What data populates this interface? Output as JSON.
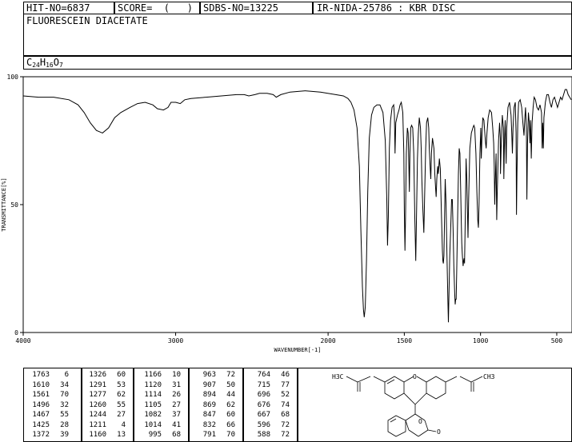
{
  "header": {
    "hit_no": "HIT-NO=6837",
    "score": "SCORE=  (   )",
    "sdbs_no": "SDBS-NO=13225",
    "method": "IR-NIDA-25786 : KBR DISC",
    "compound_name": "FLUORESCEIN DIACETATE",
    "formula": {
      "c": "C",
      "c_n": "24",
      "h": "H",
      "h_n": "16",
      "o": "O",
      "o_n": "7"
    }
  },
  "chart_data": {
    "type": "line",
    "xlabel": "WAVENUMBER[-1]",
    "ylabel": "TRANSMITTANCE[%]",
    "xlim": [
      4000,
      400
    ],
    "ylim": [
      0,
      100
    ],
    "x_ticks": [
      4000,
      3000,
      2000,
      1500,
      1000,
      500
    ],
    "y_ticks": [
      0,
      50,
      100
    ],
    "series": [
      {
        "points": [
          [
            4000,
            92.5
          ],
          [
            3900,
            92
          ],
          [
            3800,
            92
          ],
          [
            3700,
            91
          ],
          [
            3640,
            89
          ],
          [
            3600,
            86
          ],
          [
            3560,
            82
          ],
          [
            3520,
            79
          ],
          [
            3480,
            78
          ],
          [
            3440,
            80
          ],
          [
            3400,
            84
          ],
          [
            3360,
            86
          ],
          [
            3300,
            88
          ],
          [
            3250,
            89.5
          ],
          [
            3200,
            90
          ],
          [
            3150,
            89
          ],
          [
            3120,
            87.5
          ],
          [
            3080,
            87
          ],
          [
            3050,
            88
          ],
          [
            3030,
            90
          ],
          [
            3000,
            90
          ],
          [
            2970,
            89.5
          ],
          [
            2940,
            91
          ],
          [
            2900,
            91.5
          ],
          [
            2800,
            92
          ],
          [
            2700,
            92.5
          ],
          [
            2600,
            93
          ],
          [
            2550,
            93
          ],
          [
            2520,
            92.5
          ],
          [
            2480,
            93
          ],
          [
            2450,
            93.5
          ],
          [
            2400,
            93.5
          ],
          [
            2360,
            93
          ],
          [
            2340,
            92
          ],
          [
            2310,
            93
          ],
          [
            2250,
            94
          ],
          [
            2150,
            94.5
          ],
          [
            2050,
            94
          ],
          [
            1950,
            93
          ],
          [
            1900,
            92.5
          ],
          [
            1870,
            91.5
          ],
          [
            1850,
            90
          ],
          [
            1830,
            87
          ],
          [
            1810,
            80
          ],
          [
            1795,
            65
          ],
          [
            1785,
            40
          ],
          [
            1775,
            18
          ],
          [
            1768,
            9
          ],
          [
            1763,
            6
          ],
          [
            1756,
            10
          ],
          [
            1748,
            28
          ],
          [
            1740,
            55
          ],
          [
            1730,
            76
          ],
          [
            1715,
            85
          ],
          [
            1700,
            88
          ],
          [
            1680,
            89
          ],
          [
            1660,
            89
          ],
          [
            1640,
            86
          ],
          [
            1625,
            75
          ],
          [
            1615,
            52
          ],
          [
            1610,
            34
          ],
          [
            1605,
            45
          ],
          [
            1598,
            72
          ],
          [
            1590,
            83
          ],
          [
            1580,
            88
          ],
          [
            1570,
            89
          ],
          [
            1565,
            85
          ],
          [
            1561,
            70
          ],
          [
            1556,
            82
          ],
          [
            1545,
            85
          ],
          [
            1535,
            87
          ],
          [
            1528,
            89
          ],
          [
            1520,
            90
          ],
          [
            1510,
            86
          ],
          [
            1503,
            70
          ],
          [
            1500,
            48
          ],
          [
            1496,
            32
          ],
          [
            1492,
            45
          ],
          [
            1487,
            70
          ],
          [
            1480,
            80
          ],
          [
            1475,
            78
          ],
          [
            1470,
            65
          ],
          [
            1467,
            55
          ],
          [
            1463,
            70
          ],
          [
            1458,
            80
          ],
          [
            1452,
            81
          ],
          [
            1445,
            80
          ],
          [
            1438,
            70
          ],
          [
            1431,
            45
          ],
          [
            1425,
            28
          ],
          [
            1420,
            45
          ],
          [
            1414,
            68
          ],
          [
            1408,
            78
          ],
          [
            1402,
            84
          ],
          [
            1394,
            80
          ],
          [
            1389,
            72
          ],
          [
            1385,
            60
          ],
          [
            1378,
            48
          ],
          [
            1372,
            39
          ],
          [
            1367,
            52
          ],
          [
            1360,
            72
          ],
          [
            1354,
            82
          ],
          [
            1346,
            84
          ],
          [
            1340,
            80
          ],
          [
            1336,
            72
          ],
          [
            1330,
            64
          ],
          [
            1326,
            60
          ],
          [
            1322,
            70
          ],
          [
            1315,
            76
          ],
          [
            1306,
            72
          ],
          [
            1300,
            62
          ],
          [
            1294,
            56
          ],
          [
            1291,
            53
          ],
          [
            1287,
            60
          ],
          [
            1281,
            65
          ],
          [
            1277,
            62
          ],
          [
            1270,
            68
          ],
          [
            1264,
            64
          ],
          [
            1260,
            55
          ],
          [
            1256,
            45
          ],
          [
            1250,
            32
          ],
          [
            1247,
            28
          ],
          [
            1244,
            27
          ],
          [
            1240,
            30
          ],
          [
            1236,
            45
          ],
          [
            1232,
            60
          ],
          [
            1226,
            50
          ],
          [
            1220,
            30
          ],
          [
            1214,
            12
          ],
          [
            1211,
            4
          ],
          [
            1208,
            12
          ],
          [
            1202,
            30
          ],
          [
            1195,
            42
          ],
          [
            1190,
            52
          ],
          [
            1185,
            52
          ],
          [
            1180,
            40
          ],
          [
            1175,
            26
          ],
          [
            1170,
            16
          ],
          [
            1166,
            11
          ],
          [
            1163,
            13
          ],
          [
            1160,
            13
          ],
          [
            1156,
            24
          ],
          [
            1150,
            46
          ],
          [
            1145,
            62
          ],
          [
            1140,
            72
          ],
          [
            1135,
            70
          ],
          [
            1130,
            55
          ],
          [
            1126,
            42
          ],
          [
            1123,
            35
          ],
          [
            1120,
            31
          ],
          [
            1117,
            28
          ],
          [
            1114,
            26
          ],
          [
            1111,
            28
          ],
          [
            1108,
            29
          ],
          [
            1105,
            27
          ],
          [
            1100,
            45
          ],
          [
            1095,
            68
          ],
          [
            1090,
            60
          ],
          [
            1085,
            45
          ],
          [
            1082,
            37
          ],
          [
            1078,
            52
          ],
          [
            1070,
            72
          ],
          [
            1060,
            78
          ],
          [
            1050,
            80
          ],
          [
            1044,
            81
          ],
          [
            1038,
            80
          ],
          [
            1030,
            70
          ],
          [
            1024,
            55
          ],
          [
            1018,
            44
          ],
          [
            1014,
            41
          ],
          [
            1010,
            50
          ],
          [
            1004,
            70
          ],
          [
            998,
            80
          ],
          [
            995,
            68
          ],
          [
            990,
            78
          ],
          [
            985,
            84
          ],
          [
            978,
            83
          ],
          [
            972,
            78
          ],
          [
            967,
            74
          ],
          [
            963,
            72
          ],
          [
            958,
            78
          ],
          [
            950,
            84
          ],
          [
            940,
            87
          ],
          [
            928,
            86
          ],
          [
            920,
            80
          ],
          [
            914,
            74
          ],
          [
            910,
            65
          ],
          [
            907,
            50
          ],
          [
            904,
            58
          ],
          [
            898,
            70
          ],
          [
            894,
            44
          ],
          [
            890,
            55
          ],
          [
            882,
            75
          ],
          [
            875,
            82
          ],
          [
            870,
            76
          ],
          [
            869,
            62
          ],
          [
            865,
            72
          ],
          [
            857,
            85
          ],
          [
            850,
            80
          ],
          [
            847,
            60
          ],
          [
            843,
            75
          ],
          [
            838,
            83
          ],
          [
            832,
            66
          ],
          [
            828,
            80
          ],
          [
            820,
            88
          ],
          [
            810,
            90
          ],
          [
            800,
            85
          ],
          [
            795,
            78
          ],
          [
            791,
            70
          ],
          [
            787,
            80
          ],
          [
            780,
            88
          ],
          [
            772,
            90
          ],
          [
            767,
            78
          ],
          [
            764,
            46
          ],
          [
            761,
            62
          ],
          [
            756,
            82
          ],
          [
            750,
            90
          ],
          [
            740,
            91
          ],
          [
            730,
            88
          ],
          [
            722,
            82
          ],
          [
            715,
            77
          ],
          [
            710,
            83
          ],
          [
            705,
            88
          ],
          [
            699,
            80
          ],
          [
            696,
            52
          ],
          [
            692,
            74
          ],
          [
            686,
            86
          ],
          [
            680,
            82
          ],
          [
            676,
            74
          ],
          [
            672,
            83
          ],
          [
            667,
            68
          ],
          [
            662,
            82
          ],
          [
            655,
            88
          ],
          [
            648,
            92
          ],
          [
            640,
            91
          ],
          [
            630,
            88
          ],
          [
            620,
            87
          ],
          [
            610,
            89
          ],
          [
            600,
            86
          ],
          [
            596,
            72
          ],
          [
            592,
            82
          ],
          [
            588,
            72
          ],
          [
            584,
            84
          ],
          [
            575,
            90
          ],
          [
            565,
            93
          ],
          [
            555,
            93
          ],
          [
            545,
            90
          ],
          [
            535,
            88
          ],
          [
            525,
            91
          ],
          [
            515,
            92
          ],
          [
            505,
            90
          ],
          [
            495,
            88
          ],
          [
            485,
            90
          ],
          [
            475,
            92
          ],
          [
            465,
            91
          ],
          [
            455,
            93
          ],
          [
            445,
            95
          ],
          [
            435,
            95
          ],
          [
            425,
            93
          ],
          [
            415,
            92
          ],
          [
            405,
            91
          ]
        ]
      }
    ]
  },
  "peak_table": [
    [
      "1763",
      "6",
      "1326",
      "60",
      "1166",
      "10",
      "963",
      "72",
      "764",
      "46"
    ],
    [
      "1610",
      "34",
      "1291",
      "53",
      "1120",
      "31",
      "907",
      "50",
      "715",
      "77"
    ],
    [
      "1561",
      "70",
      "1277",
      "62",
      "1114",
      "26",
      "894",
      "44",
      "696",
      "52"
    ],
    [
      "1496",
      "32",
      "1260",
      "55",
      "1105",
      "27",
      "869",
      "62",
      "676",
      "74"
    ],
    [
      "1467",
      "55",
      "1244",
      "27",
      "1082",
      "37",
      "847",
      "60",
      "667",
      "68"
    ],
    [
      "1425",
      "28",
      "1211",
      "4",
      "1014",
      "41",
      "832",
      "66",
      "596",
      "72"
    ],
    [
      "1372",
      "39",
      "1160",
      "13",
      "995",
      "68",
      "791",
      "70",
      "588",
      "72"
    ]
  ],
  "structure_labels": {
    "left_ch3": "H3C",
    "right_ch3": "CH3",
    "ring_o": "O",
    "lactone_o": "O",
    "carbonyl_o": "O"
  }
}
